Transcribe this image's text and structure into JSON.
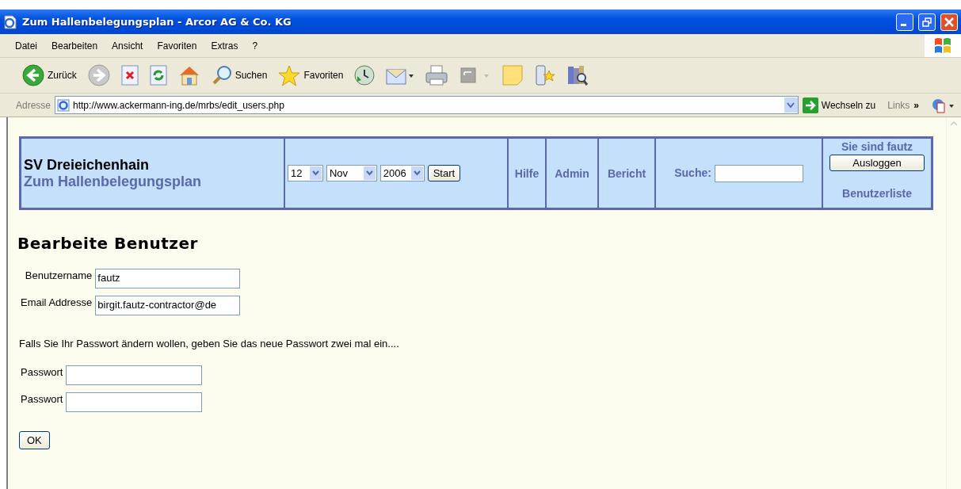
{
  "window": {
    "title": "Zum Hallenbelegungsplan - Arcor AG & Co. KG"
  },
  "menu": [
    {
      "label": "Datei"
    },
    {
      "label": "Bearbeiten"
    },
    {
      "label": "Ansicht"
    },
    {
      "label": "Favoriten"
    },
    {
      "label": "Extras"
    },
    {
      "label": "?"
    }
  ],
  "toolbar": [
    {
      "kind": "back",
      "label": "Zurück"
    },
    {
      "kind": "forward"
    },
    {
      "kind": "stop"
    },
    {
      "kind": "refresh"
    },
    {
      "kind": "home"
    },
    {
      "kind": "search",
      "label": "Suchen"
    },
    {
      "kind": "favorites",
      "label": "Favoriten"
    },
    {
      "kind": "history"
    },
    {
      "kind": "mail"
    },
    {
      "kind": "print"
    },
    {
      "kind": "edit"
    },
    {
      "kind": "note"
    },
    {
      "kind": "messenger"
    },
    {
      "kind": "research"
    }
  ],
  "address_bar": {
    "label": "Adresse",
    "url": "http://www.ackermann-ing.de/mrbs/edit_users.php",
    "go": "Wechseln zu",
    "links": "Links",
    "more": "»"
  },
  "header": {
    "site": "SV Dreieichenhain",
    "link": "Zum Hallenbelegungsplan",
    "day": "12",
    "month": "Nov",
    "year": "2006",
    "start": "Start",
    "nav": [
      {
        "label": "Hilfe"
      },
      {
        "label": "Admin"
      },
      {
        "label": "Bericht"
      }
    ],
    "search_label": "Suche:",
    "user": "Sie sind fautz",
    "logout": "Ausloggen",
    "user_list": "Benutzerliste"
  },
  "form": {
    "heading": "Bearbeite Benutzer",
    "fields": [
      {
        "label": "Benutzername",
        "value": "fautz"
      },
      {
        "label": "Email Addresse",
        "value": "birgit.fautz-contractor@de"
      }
    ],
    "note": "Falls Sie Ihr Passwort ändern wollen, geben Sie das neue Passwort zwei mal ein....",
    "password_fields": [
      {
        "label": "Passwort"
      },
      {
        "label": "Passwort"
      }
    ],
    "submit": "OK"
  }
}
